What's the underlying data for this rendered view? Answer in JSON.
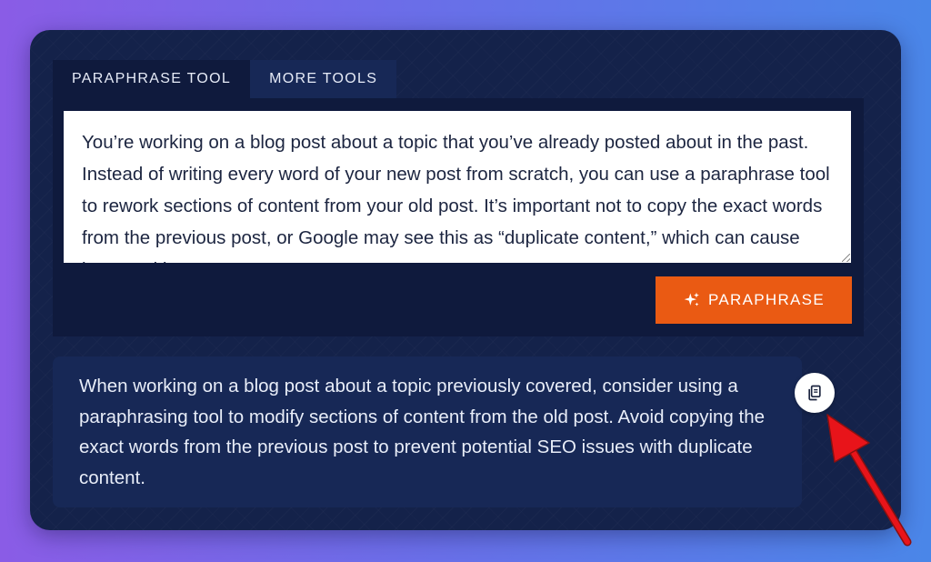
{
  "tabs": [
    {
      "label": "PARAPHRASE TOOL",
      "active": true
    },
    {
      "label": "MORE TOOLS",
      "active": false
    }
  ],
  "input": {
    "value": "You’re working on a blog post about a topic that you’ve already posted about in the past. Instead of writing every word of your new post from scratch, you can use a paraphrase tool to rework sections of content from your old post. It’s important not to copy the exact words from the previous post, or Google may see this as “duplicate content,” which can cause issues with"
  },
  "actions": {
    "paraphrase_label": "PARAPHRASE",
    "paraphrase_icon": "sparkle-icon"
  },
  "output": {
    "text": "When working on a blog post about a topic previously covered, consider using a paraphrasing tool to modify sections of content from the old post. Avoid copying the exact words from the previous post to prevent potential SEO issues with duplicate content.",
    "copy_icon": "copy-icon"
  },
  "colors": {
    "background_left": "#8a5ce6",
    "background_right": "#4a86e8",
    "card": "#14224a",
    "panel": "#0f1a3d",
    "accent": "#ea5a13",
    "annotation_arrow": "#e8141a"
  }
}
